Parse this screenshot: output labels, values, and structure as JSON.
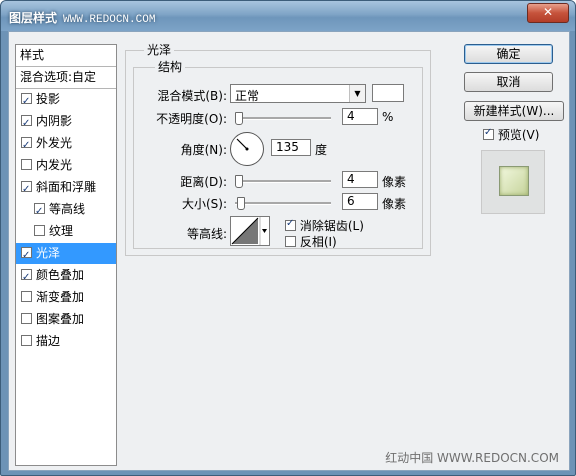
{
  "window": {
    "title": "图层样式",
    "title_url": "WWW.REDOCN.COM",
    "close_glyph": "✕"
  },
  "left_panel": {
    "header": "样式",
    "blend_options": "混合选项:自定",
    "items": [
      {
        "label": "投影",
        "checked": true
      },
      {
        "label": "内阴影",
        "checked": true
      },
      {
        "label": "外发光",
        "checked": true
      },
      {
        "label": "内发光",
        "checked": false
      },
      {
        "label": "斜面和浮雕",
        "checked": true
      },
      {
        "label": "等高线",
        "checked": true
      },
      {
        "label": "纹理",
        "checked": false
      },
      {
        "label": "光泽",
        "checked": true,
        "selected": true
      },
      {
        "label": "颜色叠加",
        "checked": true
      },
      {
        "label": "渐变叠加",
        "checked": false
      },
      {
        "label": "图案叠加",
        "checked": false
      },
      {
        "label": "描边",
        "checked": false
      }
    ]
  },
  "satin": {
    "group_title": "光泽",
    "structure_title": "结构",
    "blend_mode_label": "混合模式(B):",
    "blend_mode_value": "正常",
    "opacity_label": "不透明度(O):",
    "opacity_value": "4",
    "opacity_unit": "%",
    "angle_label": "角度(N):",
    "angle_value": "135",
    "angle_unit": "度",
    "distance_label": "距离(D):",
    "distance_value": "4",
    "distance_unit": "像素",
    "size_label": "大小(S):",
    "size_value": "6",
    "size_unit": "像素",
    "contour_label": "等高线:",
    "antialias_label": "消除锯齿(L)",
    "antialias_checked": true,
    "invert_label": "反相(I)",
    "invert_checked": false
  },
  "buttons": {
    "ok": "确定",
    "cancel": "取消",
    "new_style": "新建样式(W)...",
    "preview_label": "预览(V)",
    "preview_checked": true
  },
  "watermark": "红动中国 WWW.REDOCN.COM"
}
